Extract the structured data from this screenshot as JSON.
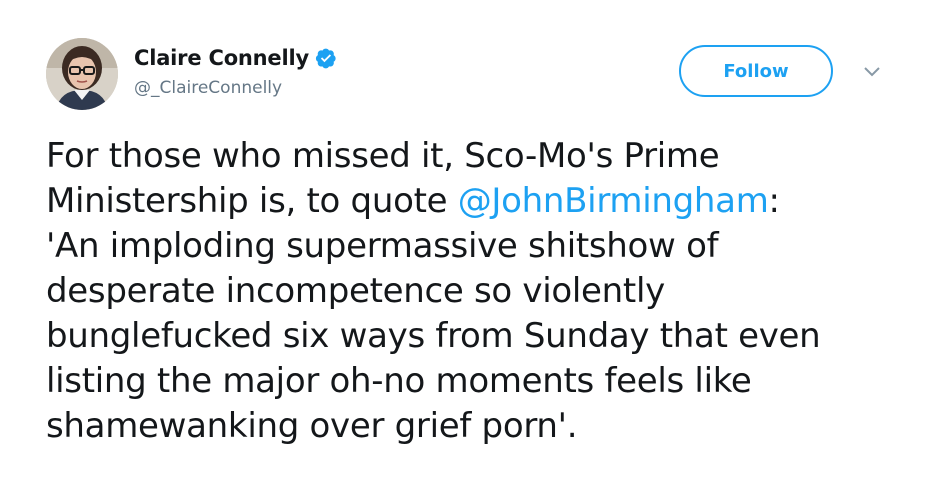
{
  "author": {
    "display_name": "Claire Connelly",
    "handle": "@_ClaireConnelly",
    "verified": true,
    "verified_icon": "verified-badge-icon"
  },
  "actions": {
    "follow_label": "Follow",
    "menu_icon": "chevron-down-icon"
  },
  "tweet": {
    "lines": [
      {
        "text": "For those who missed it, Sco-Mo's Prime"
      },
      {
        "before": "Ministership is, to quote ",
        "mention": "@JohnBirmingham",
        "after": ":"
      },
      {
        "text": "'An imploding supermassive shitshow of"
      },
      {
        "text": "desperate incompetence so violently"
      },
      {
        "text": "bunglefucked six ways from Sunday that even"
      },
      {
        "text": "listing the major oh-no moments feels like"
      },
      {
        "text": "shamewanking over grief porn'."
      }
    ]
  },
  "colors": {
    "accent": "#1da1f2",
    "text": "#14171a",
    "secondary_text": "#657786"
  }
}
